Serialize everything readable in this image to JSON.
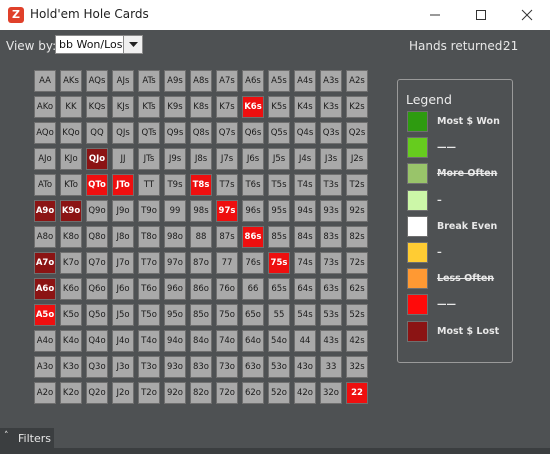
{
  "window": {
    "title": "Hold'em Hole Cards",
    "icon_text": "Z",
    "icon_color": "#e0402a"
  },
  "toolbar": {
    "view_by_label": "View by:",
    "view_by_value": "bb Won/Lost",
    "hands_label": "Hands returned:",
    "hands_value": "21"
  },
  "grid": {
    "rows": [
      [
        "AA",
        "AKs",
        "AQs",
        "AJs",
        "ATs",
        "A9s",
        "A8s",
        "A7s",
        "A6s",
        "A5s",
        "A4s",
        "A3s",
        "A2s"
      ],
      [
        "AKo",
        "KK",
        "KQs",
        "KJs",
        "KTs",
        "K9s",
        "K8s",
        "K7s",
        "K6s",
        "K5s",
        "K4s",
        "K3s",
        "K2s"
      ],
      [
        "AQo",
        "KQo",
        "QQ",
        "QJs",
        "QTs",
        "Q9s",
        "Q8s",
        "Q7s",
        "Q6s",
        "Q5s",
        "Q4s",
        "Q3s",
        "Q2s"
      ],
      [
        "AJo",
        "KJo",
        "QJo",
        "JJ",
        "JTs",
        "J9s",
        "J8s",
        "J7s",
        "J6s",
        "J5s",
        "J4s",
        "J3s",
        "J2s"
      ],
      [
        "ATo",
        "KTo",
        "QTo",
        "JTo",
        "TT",
        "T9s",
        "T8s",
        "T7s",
        "T6s",
        "T5s",
        "T4s",
        "T3s",
        "T2s"
      ],
      [
        "A9o",
        "K9o",
        "Q9o",
        "J9o",
        "T9o",
        "99",
        "98s",
        "97s",
        "96s",
        "95s",
        "94s",
        "93s",
        "92s"
      ],
      [
        "A8o",
        "K8o",
        "Q8o",
        "J8o",
        "T8o",
        "98o",
        "88",
        "87s",
        "86s",
        "85s",
        "84s",
        "83s",
        "82s"
      ],
      [
        "A7o",
        "K7o",
        "Q7o",
        "J7o",
        "T7o",
        "97o",
        "87o",
        "77",
        "76s",
        "75s",
        "74s",
        "73s",
        "72s"
      ],
      [
        "A6o",
        "K6o",
        "Q6o",
        "J6o",
        "T6o",
        "96o",
        "86o",
        "76o",
        "66",
        "65s",
        "64s",
        "63s",
        "62s"
      ],
      [
        "A5o",
        "K5o",
        "Q5o",
        "J5o",
        "T5o",
        "95o",
        "85o",
        "75o",
        "65o",
        "55",
        "54s",
        "53s",
        "52s"
      ],
      [
        "A4o",
        "K4o",
        "Q4o",
        "J4o",
        "T4o",
        "94o",
        "84o",
        "74o",
        "64o",
        "54o",
        "44",
        "43s",
        "42s"
      ],
      [
        "A3o",
        "K3o",
        "Q3o",
        "J3o",
        "T3o",
        "93o",
        "83o",
        "73o",
        "63o",
        "53o",
        "43o",
        "33",
        "32s"
      ],
      [
        "A2o",
        "K2o",
        "Q2o",
        "J2o",
        "T2o",
        "92o",
        "82o",
        "72o",
        "62o",
        "52o",
        "42o",
        "32o",
        "22"
      ]
    ],
    "highlights": {
      "K6s": "red",
      "QJo": "dark",
      "QTo": "red",
      "JTo": "red",
      "T8s": "red",
      "A9o": "dark",
      "K9o": "dark",
      "97s": "red",
      "86s": "red",
      "A7o": "dark",
      "75s": "red",
      "A6o": "dark",
      "A5o": "red",
      "22": "red"
    },
    "colors": {
      "neutral": "#a9a9a9",
      "red": "#ee0f0f",
      "dark": "#8b1414"
    }
  },
  "legend": {
    "title": "Legend",
    "items": [
      {
        "label": "Most $ Won",
        "color": "#2e9b10",
        "strike": false
      },
      {
        "label": "——",
        "color": "#66cc1e",
        "strike": false
      },
      {
        "label": "More Often",
        "color": "#99c46a",
        "strike": true
      },
      {
        "label": "–",
        "color": "#ccf7a8",
        "strike": false
      },
      {
        "label": "Break Even",
        "color": "#ffffff",
        "strike": false
      },
      {
        "label": "–",
        "color": "#ffcc33",
        "strike": false
      },
      {
        "label": "Less Often",
        "color": "#ff9933",
        "strike": true
      },
      {
        "label": "——",
        "color": "#ff0a0a",
        "strike": false
      },
      {
        "label": "Most $ Lost",
        "color": "#8b1414",
        "strike": false
      }
    ]
  },
  "footer": {
    "filters_label": "Filters"
  }
}
